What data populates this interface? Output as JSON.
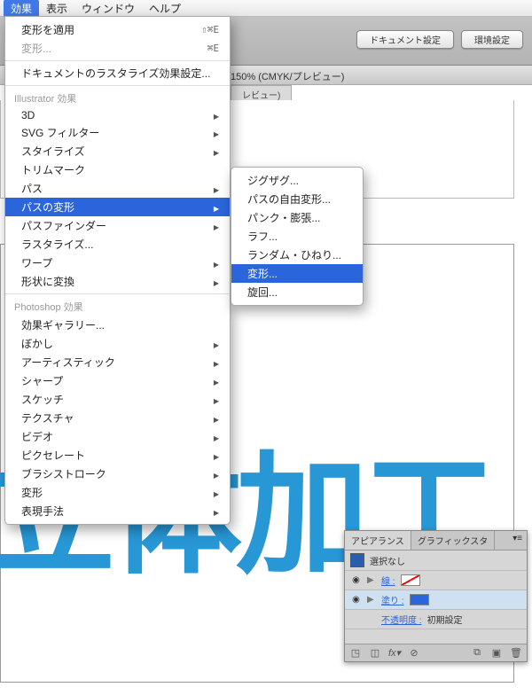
{
  "menubar": {
    "items": [
      "効果",
      "表示",
      "ウィンドウ",
      "ヘルプ"
    ],
    "selected_index": 0
  },
  "toolbar": {
    "btn_doc_setup": "ドキュメント設定",
    "btn_prefs": "環境設定"
  },
  "document": {
    "title_suffix": "150% (CMYK/プレビュー)",
    "tab_suffix": "レビュー)"
  },
  "dropdown": {
    "top": [
      {
        "label": "変形を適用",
        "shortcut": "⇧⌘E"
      },
      {
        "label": "変形...",
        "shortcut": "⌘E",
        "disabled": true
      }
    ],
    "rasterize": "ドキュメントのラスタライズ効果設定...",
    "cat_illustrator": "Illustrator 効果",
    "illustrator_items": [
      "3D",
      "SVG フィルター",
      "スタイライズ",
      "トリムマーク",
      "パス",
      "パスの変形",
      "パスファインダー",
      "ラスタライズ...",
      "ワープ",
      "形状に変換"
    ],
    "highlight_index": 5,
    "no_arrow": [
      3,
      7
    ],
    "cat_photoshop": "Photoshop 効果",
    "photoshop_items": [
      "効果ギャラリー...",
      "ぼかし",
      "アーティスティック",
      "シャープ",
      "スケッチ",
      "テクスチャ",
      "ビデオ",
      "ピクセレート",
      "ブラシストローク",
      "変形",
      "表現手法"
    ],
    "ps_no_arrow": [
      0
    ]
  },
  "submenu": {
    "items": [
      "ジグザグ...",
      "パスの自由変形...",
      "パンク・膨張...",
      "ラフ...",
      "ランダム・ひねり...",
      "変形...",
      "旋回..."
    ],
    "highlight_index": 5
  },
  "canvas": {
    "big_text": "立体加工"
  },
  "panel": {
    "tabs": [
      "アピアランス",
      "グラフィックスタ"
    ],
    "selection": "選択なし",
    "rows": {
      "stroke_label": "線 :",
      "fill_label": "塗り :",
      "opacity_label": "不透明度 :",
      "opacity_value": "初期設定"
    },
    "fill_color": "#2b65db"
  }
}
